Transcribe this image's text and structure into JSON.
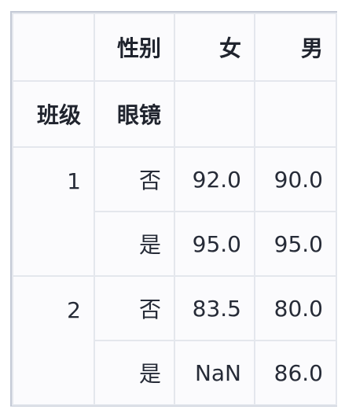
{
  "table": {
    "column_index_name": "性别",
    "columns": [
      "女",
      "男"
    ],
    "index_names": [
      "班级",
      "眼镜"
    ],
    "rows": [
      {
        "class": "1",
        "glasses": "否",
        "values": [
          "92.0",
          "90.0"
        ]
      },
      {
        "class": "",
        "glasses": "是",
        "values": [
          "95.0",
          "95.0"
        ]
      },
      {
        "class": "2",
        "glasses": "否",
        "values": [
          "83.5",
          "80.0"
        ]
      },
      {
        "class": "",
        "glasses": "是",
        "values": [
          "NaN",
          "86.0"
        ]
      }
    ]
  }
}
